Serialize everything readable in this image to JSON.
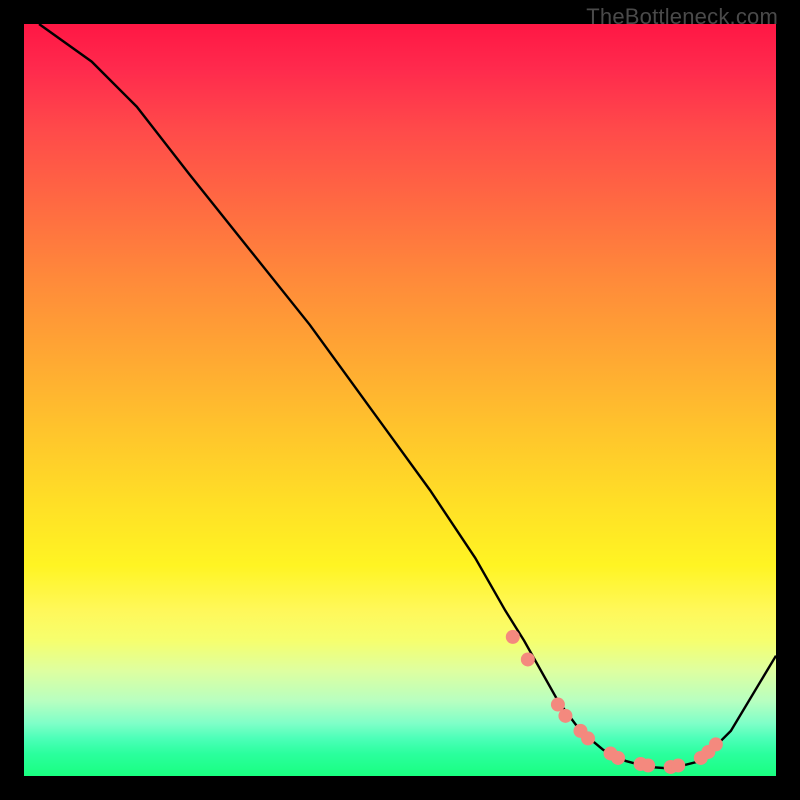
{
  "watermark": "TheBottleneck.com",
  "chart_data": {
    "type": "line",
    "title": "",
    "xlabel": "",
    "ylabel": "",
    "xlim": [
      0,
      100
    ],
    "ylim": [
      0,
      100
    ],
    "grid": false,
    "legend": false,
    "series": [
      {
        "name": "curve",
        "x": [
          2,
          9,
          15,
          22,
          30,
          38,
          46,
          54,
          60,
          64,
          66.5,
          71,
          74,
          77,
          80,
          83,
          86,
          90,
          94,
          100
        ],
        "y": [
          100,
          95,
          89,
          80,
          70,
          60,
          49,
          38,
          29,
          22,
          18,
          10,
          6,
          3.5,
          2,
          1.2,
          1,
          2,
          6,
          16
        ]
      }
    ],
    "markers": [
      {
        "x": 65,
        "y": 18.5
      },
      {
        "x": 67,
        "y": 15.5
      },
      {
        "x": 71,
        "y": 9.5
      },
      {
        "x": 72,
        "y": 8
      },
      {
        "x": 74,
        "y": 6
      },
      {
        "x": 75,
        "y": 5
      },
      {
        "x": 78,
        "y": 3
      },
      {
        "x": 79,
        "y": 2.4
      },
      {
        "x": 82,
        "y": 1.6
      },
      {
        "x": 83,
        "y": 1.4
      },
      {
        "x": 86,
        "y": 1.2
      },
      {
        "x": 87,
        "y": 1.4
      },
      {
        "x": 90,
        "y": 2.4
      },
      {
        "x": 91,
        "y": 3.2
      },
      {
        "x": 92,
        "y": 4.2
      }
    ],
    "marker_radius": 7,
    "colors": {
      "curve": "#000000",
      "markers": "#f4897e",
      "gradient_top": "#ff1744",
      "gradient_bottom": "#19ff80"
    }
  }
}
